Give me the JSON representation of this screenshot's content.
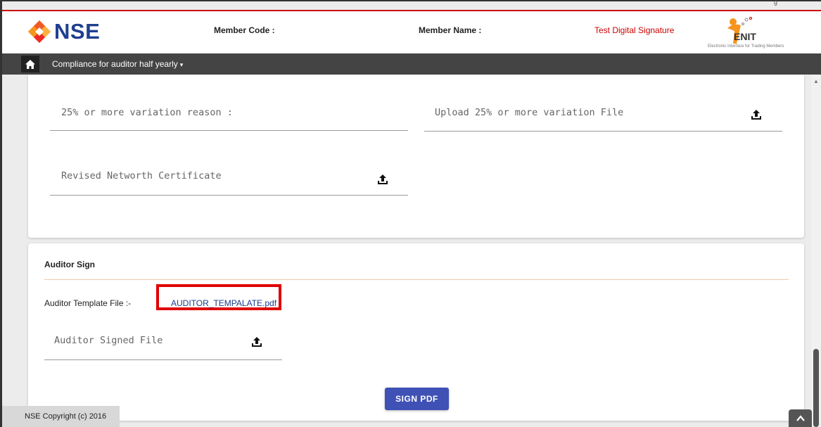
{
  "header": {
    "logo_text": "NSE",
    "member_code_label": "Member Code :",
    "member_name_label": "Member Name :",
    "member_name_value": "Test Digital Signature",
    "enit_title": "ENIT",
    "enit_subtitle": "Electronic Interface for Trading Members",
    "corner_text": "g"
  },
  "navbar": {
    "menu_label": "Compliance for auditor half yearly",
    "caret": "▾"
  },
  "variation_section": {
    "variation_reason_label": "25% or more variation reason :",
    "variation_file_label": "Upload 25% or more variation File",
    "networth_label": "Revised Networth Certificate"
  },
  "auditor_sign": {
    "title": "Auditor Sign",
    "template_label": "Auditor Template File :-",
    "template_link": "AUDITOR_TEMPALATE.pdf",
    "signed_file_label": "Auditor Signed File",
    "sign_button": "SIGN PDF"
  },
  "footer": {
    "copyright": "NSE Copyright (c) 2016"
  },
  "colors": {
    "brand_blue": "#1f3f8f",
    "button_indigo": "#3f51b5",
    "highlight_red": "#e00000",
    "nav_dark": "#444444"
  }
}
